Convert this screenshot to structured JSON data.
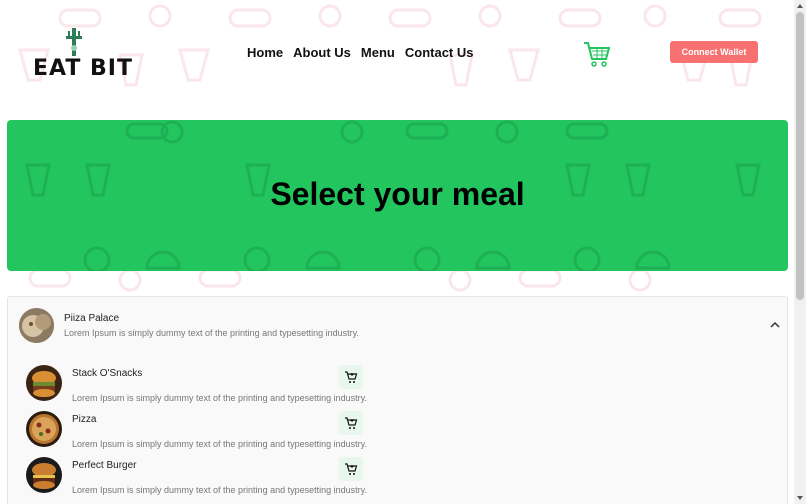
{
  "brand": {
    "name": "EAT BIT"
  },
  "nav": {
    "items": [
      {
        "label": "Home"
      },
      {
        "label": "About Us"
      },
      {
        "label": "Menu"
      },
      {
        "label": "Contact Us"
      }
    ]
  },
  "header": {
    "cart_icon": "cart-icon",
    "wallet_label": "Connect Wallet"
  },
  "hero": {
    "title": "Select your meal"
  },
  "restaurant": {
    "name": "Piiza Palace",
    "description": "Lorem Ipsum is simply dummy text of the printing and typesetting industry.",
    "expanded": true,
    "items": [
      {
        "name": "Stack O'Snacks",
        "description": "Lorem Ipsum is simply dummy text of the printing and typesetting industry."
      },
      {
        "name": "Pizza",
        "description": "Lorem Ipsum is simply dummy text of the printing and typesetting industry."
      },
      {
        "name": "Perfect Burger",
        "description": "Lorem Ipsum is simply dummy text of the printing and typesetting industry."
      }
    ]
  },
  "colors": {
    "hero_bg": "#22c55e",
    "wallet_button": "#f87171",
    "cart_accent": "#22c55e"
  }
}
